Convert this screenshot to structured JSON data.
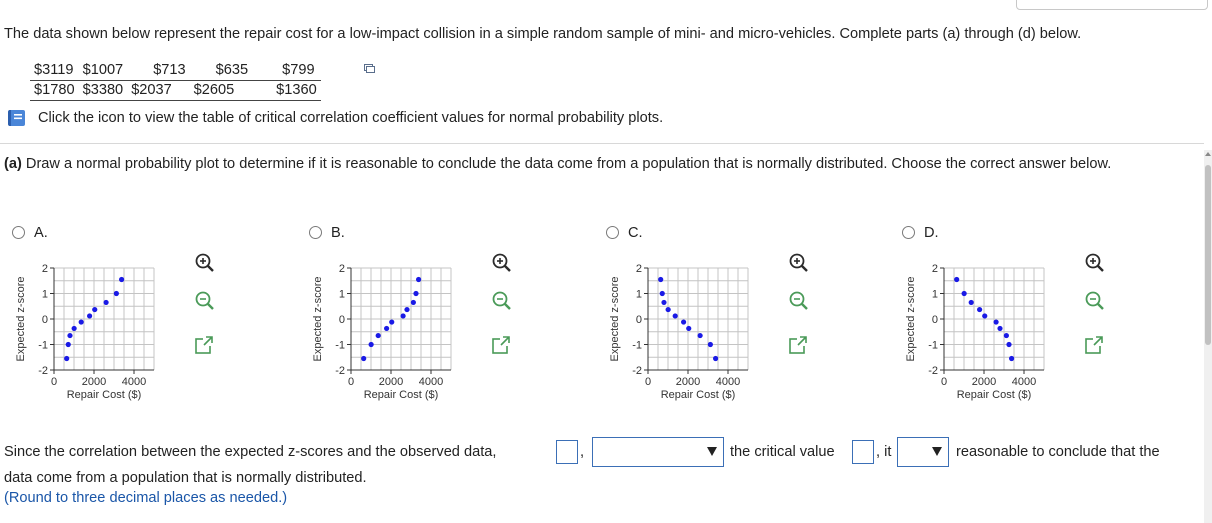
{
  "intro_text": "The data shown below represent the repair cost for a low-impact collision in a simple random sample of mini- and micro-vehicles. Complete parts (a) through (d) below.",
  "data_rows": [
    [
      "$3119",
      "$1007",
      "$713",
      "$635",
      "$799"
    ],
    [
      "$1780",
      "$3380",
      "$2037",
      "$2605",
      "$1360"
    ]
  ],
  "book_link_text": "Click the icon to view the table of critical correlation coefficient values for normal probability plots.",
  "question_prefix": "(a)",
  "question_text": " Draw a normal probability plot to determine if it is reasonable to conclude the data come from a population that is normally distributed. Choose the correct answer below.",
  "options": [
    {
      "label": "A."
    },
    {
      "label": "B."
    },
    {
      "label": "C."
    },
    {
      "label": "D."
    }
  ],
  "chart_data": [
    {
      "type": "scatter",
      "xlabel": "Repair Cost ($)",
      "ylabel": "Expected z-score",
      "xlim": [
        0,
        5000
      ],
      "ylim": [
        -2,
        2
      ],
      "x_ticks": [
        "0",
        "2000",
        "4000"
      ],
      "y_ticks": [
        "2",
        "1",
        "0",
        "-1",
        "-2"
      ],
      "points": [
        [
          635,
          -1.55
        ],
        [
          713,
          -1.0
        ],
        [
          799,
          -0.65
        ],
        [
          1007,
          -0.37
        ],
        [
          1360,
          -0.12
        ],
        [
          1780,
          0.12
        ],
        [
          2037,
          0.37
        ],
        [
          2605,
          0.65
        ],
        [
          3119,
          1.0
        ],
        [
          3380,
          1.55
        ]
      ]
    },
    {
      "type": "scatter",
      "xlabel": "Repair Cost ($)",
      "ylabel": "Expected z-score",
      "xlim": [
        0,
        5000
      ],
      "ylim": [
        -2,
        2
      ],
      "x_ticks": [
        "0",
        "2000",
        "4000"
      ],
      "y_ticks": [
        "2",
        "1",
        "0",
        "-1",
        "-2"
      ],
      "points": [
        [
          635,
          -1.55
        ],
        [
          1007,
          -1.0
        ],
        [
          1360,
          -0.65
        ],
        [
          1780,
          -0.37
        ],
        [
          2037,
          -0.12
        ],
        [
          2605,
          0.12
        ],
        [
          2800,
          0.37
        ],
        [
          3119,
          0.65
        ],
        [
          3250,
          1.0
        ],
        [
          3380,
          1.55
        ]
      ]
    },
    {
      "type": "scatter",
      "xlabel": "Repair Cost ($)",
      "ylabel": "Expected z-score",
      "xlim": [
        0,
        5000
      ],
      "ylim": [
        -2,
        2
      ],
      "x_ticks": [
        "0",
        "2000",
        "4000"
      ],
      "y_ticks": [
        "2",
        "1",
        "0",
        "-1",
        "-2"
      ],
      "points": [
        [
          635,
          1.55
        ],
        [
          713,
          1.0
        ],
        [
          799,
          0.65
        ],
        [
          1007,
          0.37
        ],
        [
          1360,
          0.12
        ],
        [
          1780,
          -0.12
        ],
        [
          2037,
          -0.37
        ],
        [
          2605,
          -0.65
        ],
        [
          3119,
          -1.0
        ],
        [
          3380,
          -1.55
        ]
      ]
    },
    {
      "type": "scatter",
      "xlabel": "Repair Cost ($)",
      "ylabel": "Expected z-score",
      "xlim": [
        0,
        5000
      ],
      "ylim": [
        -2,
        2
      ],
      "x_ticks": [
        "0",
        "2000",
        "4000"
      ],
      "y_ticks": [
        "2",
        "1",
        "0",
        "-1",
        "-2"
      ],
      "points": [
        [
          635,
          1.55
        ],
        [
          1007,
          1.0
        ],
        [
          1360,
          0.65
        ],
        [
          1780,
          0.37
        ],
        [
          2037,
          0.12
        ],
        [
          2605,
          -0.12
        ],
        [
          2800,
          -0.37
        ],
        [
          3119,
          -0.65
        ],
        [
          3250,
          -1.0
        ],
        [
          3380,
          -1.55
        ]
      ]
    }
  ],
  "colors": {
    "point": "#1a1ae6",
    "grid": "#c4c4c4",
    "link": "#1a56a8",
    "input_border": "#3b6fb6"
  },
  "answer": {
    "part1": "Since the correlation between the expected z-scores and the observed data,",
    "comma": ",",
    "part2": "the critical value",
    "comma2": ", it",
    "part3": "reasonable to conclude that the",
    "line2": "data come from a population that is normally distributed.",
    "round_note": "(Round to three decimal places as needed.)"
  },
  "tool_icons": [
    "zoom-in-icon",
    "zoom-out-icon",
    "expand-icon"
  ]
}
